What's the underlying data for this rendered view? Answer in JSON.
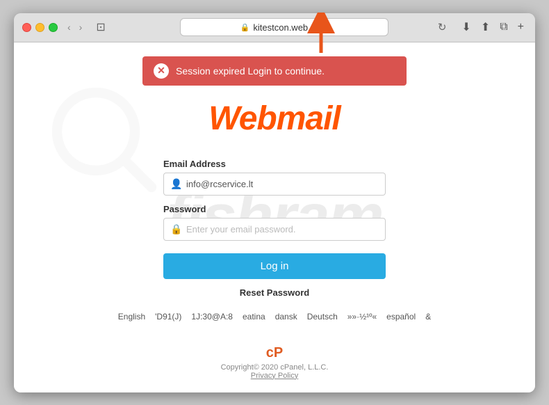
{
  "browser": {
    "url": "kitestcon.web.app",
    "lock_symbol": "🔒"
  },
  "alert": {
    "message": "Session expired Login to continue.",
    "icon": "✕"
  },
  "logo": {
    "text": "Webmail"
  },
  "form": {
    "email_label": "Email Address",
    "email_value": "info@rcservice.lt",
    "email_placeholder": "info@rcservice.lt",
    "password_label": "Password",
    "password_placeholder": "Enter your email password.",
    "login_button": "Log in",
    "reset_link": "Reset Password"
  },
  "languages": [
    "English",
    "'D91(J)",
    "1J:30@A:8",
    "eatina",
    "dansk",
    "Deutsch",
    "»»·½¹º«",
    "español",
    "&"
  ],
  "footer": {
    "logo": "cP",
    "copyright": "Copyright© 2020 cPanel, L.L.C.",
    "privacy": "Privacy Policy"
  },
  "watermark": {
    "text": "fishram"
  }
}
